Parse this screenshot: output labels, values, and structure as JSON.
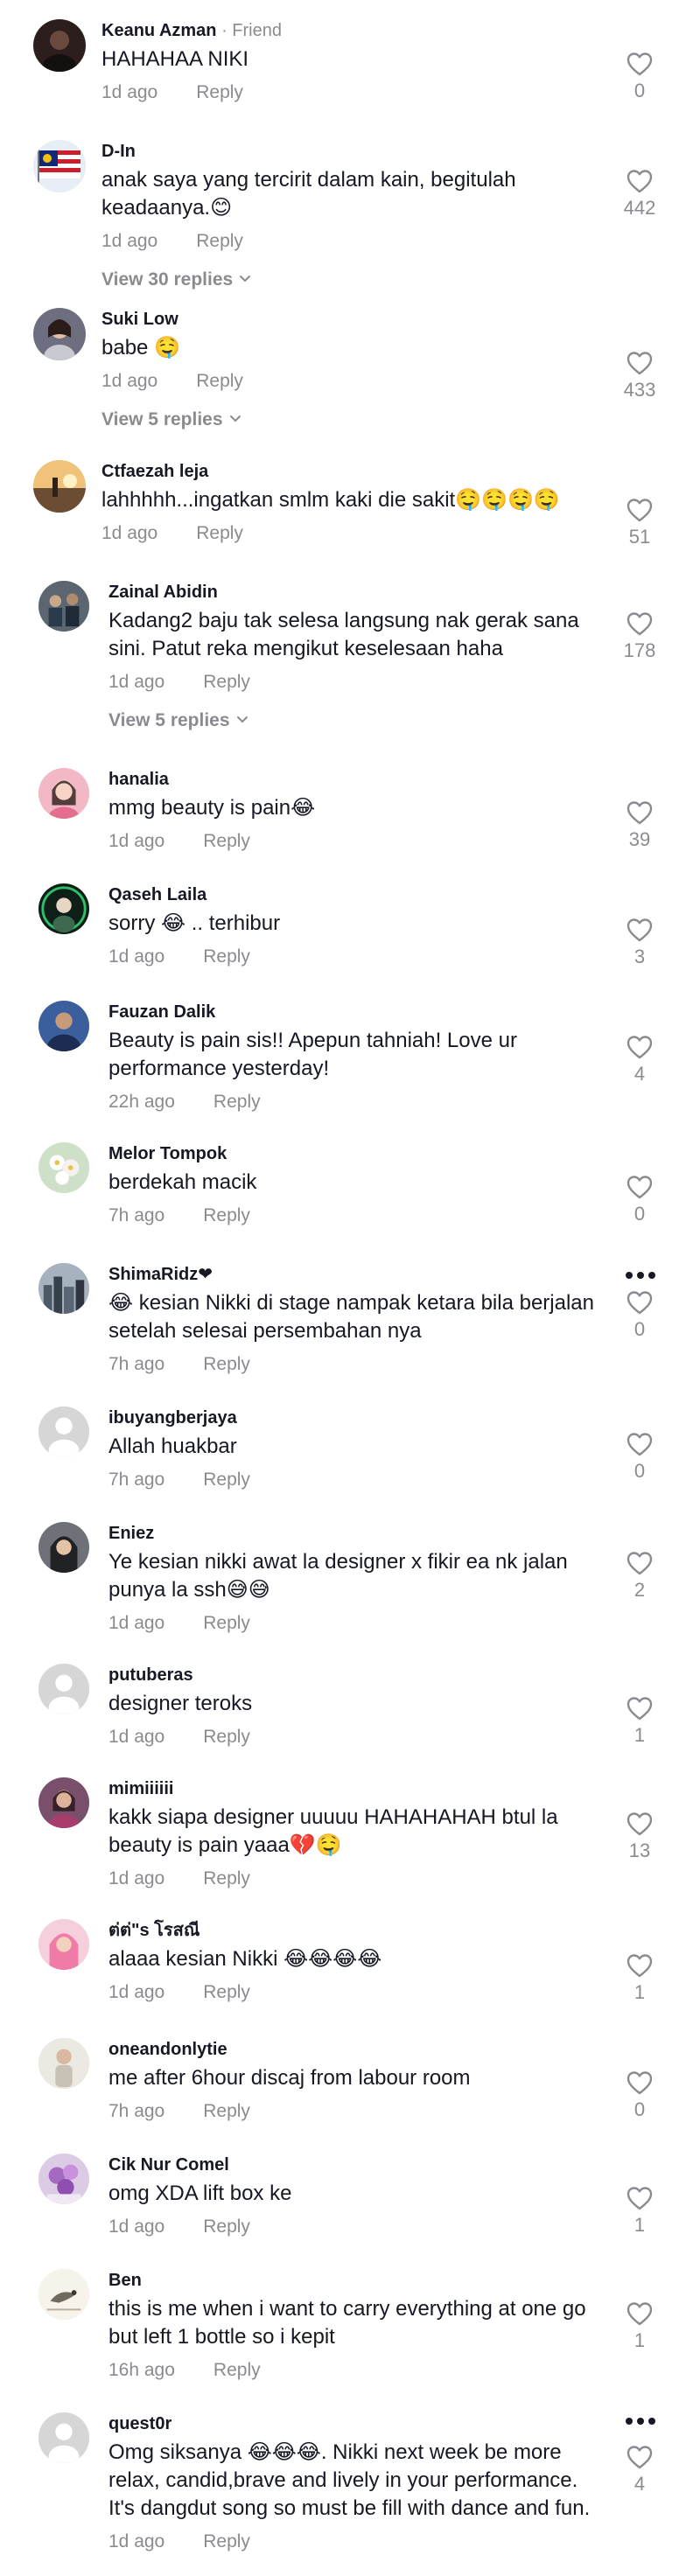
{
  "colors": {
    "text": "#161823",
    "muted": "#8a8b91",
    "background": "#ffffff"
  },
  "friend_label": "· Friend",
  "view_replies_icon": "chevron-down-icon",
  "like_icon": "heart-outline-icon",
  "more_icon": "more-horizontal-icon",
  "comments": [
    {
      "username": "Keanu Azman",
      "friend": true,
      "text": "HAHAHAA NIKI",
      "time": "1d ago",
      "reply_label": "Reply",
      "likes": "0",
      "avatar_icon": "avatar-dark-portrait"
    },
    {
      "username": "D-In",
      "text": "anak saya yang tercirit dalam kain, begitulah keadaanya.😊",
      "time": "1d ago",
      "reply_label": "Reply",
      "likes": "442",
      "view_replies": "View 30 replies",
      "avatar_icon": "avatar-flag"
    },
    {
      "username": "Suki Low",
      "text": "babe 🤤",
      "time": "1d ago",
      "reply_label": "Reply",
      "likes": "433",
      "view_replies": "View 5 replies",
      "avatar_icon": "avatar-portrait"
    },
    {
      "username": "Ctfaezah leja",
      "text": "lahhhhh...ingatkan smlm kaki die sakit🤤🤤🤤🤤",
      "time": "1d ago",
      "reply_label": "Reply",
      "likes": "51",
      "avatar_icon": "avatar-sunset"
    },
    {
      "username": "Zainal Abidin",
      "text": "Kadang2 baju tak selesa langsung nak gerak sana sini. Patut reka mengikut keselesaan haha",
      "time": "1d ago",
      "reply_label": "Reply",
      "likes": "178",
      "view_replies": "View 5 replies",
      "avatar_icon": "avatar-group"
    },
    {
      "username": "hanalia",
      "text": "mmg beauty is pain😂",
      "time": "1d ago",
      "reply_label": "Reply",
      "likes": "39",
      "avatar_icon": "avatar-pink-portrait"
    },
    {
      "username": "Qaseh Laila",
      "text": "sorry 😂 .. terhibur",
      "time": "1d ago",
      "reply_label": "Reply",
      "likes": "3",
      "avatar_icon": "avatar-green-ring"
    },
    {
      "username": "Fauzan Dalik",
      "text": "Beauty is pain sis!! Apepun tahniah! Love ur performance yesterday!",
      "time": "22h ago",
      "reply_label": "Reply",
      "likes": "4",
      "avatar_icon": "avatar-blue-portrait"
    },
    {
      "username": "Melor Tompok",
      "text": "berdekah macik",
      "time": "7h ago",
      "reply_label": "Reply",
      "likes": "0",
      "avatar_icon": "avatar-flowers"
    },
    {
      "username": "ShimaRidz❤",
      "text": "😂 kesian Nikki di stage nampak ketara bila berjalan setelah selesai persembahan nya",
      "time": "7h ago",
      "reply_label": "Reply",
      "likes": "0",
      "more": true,
      "avatar_icon": "avatar-cityscape"
    },
    {
      "username": "ibuyangberjaya",
      "text": "Allah huakbar",
      "time": "7h ago",
      "reply_label": "Reply",
      "likes": "0",
      "avatar_icon": "avatar-default"
    },
    {
      "username": "Eniez",
      "text": "Ye kesian nikki awat la designer x fikir ea nk jalan punya la ssh😅😅",
      "time": "1d ago",
      "reply_label": "Reply",
      "likes": "2",
      "avatar_icon": "avatar-hijab-portrait"
    },
    {
      "username": "putuberas",
      "text": "designer teroks",
      "time": "1d ago",
      "reply_label": "Reply",
      "likes": "1",
      "avatar_icon": "avatar-default"
    },
    {
      "username": "mimiiiiii",
      "text": "kakk siapa designer uuuuu HAHAHAHAH btul la beauty is pain yaaa💔🤤",
      "time": "1d ago",
      "reply_label": "Reply",
      "likes": "13",
      "avatar_icon": "avatar-purple-portrait"
    },
    {
      "username": "ต่ต่\"s โรสณี",
      "text": "alaaa kesian Nikki 😂😂😂😂",
      "time": "1d ago",
      "reply_label": "Reply",
      "likes": "1",
      "avatar_icon": "avatar-pink-hijab"
    },
    {
      "username": "oneandonlytie",
      "text": "me after 6hour discaj from labour room",
      "time": "7h ago",
      "reply_label": "Reply",
      "likes": "0",
      "avatar_icon": "avatar-light-portrait"
    },
    {
      "username": "Cik Nur Comel",
      "text": "omg XDA lift box ke",
      "time": "1d ago",
      "reply_label": "Reply",
      "likes": "1",
      "avatar_icon": "avatar-flowers-purple"
    },
    {
      "username": "Ben",
      "text": "this is me when i want to carry everything at one go but left 1 bottle so i kepit",
      "time": "16h ago",
      "reply_label": "Reply",
      "likes": "1",
      "avatar_icon": "avatar-bird-sketch"
    },
    {
      "username": "quest0r",
      "text": "Omg siksanya 😂😂😂. Nikki next week be more relax, candid,brave and lively in your performance. It's dangdut song so must be fill with dance and fun.",
      "time": "1d ago",
      "reply_label": "Reply",
      "likes": "4",
      "more": true,
      "avatar_icon": "avatar-default"
    }
  ]
}
